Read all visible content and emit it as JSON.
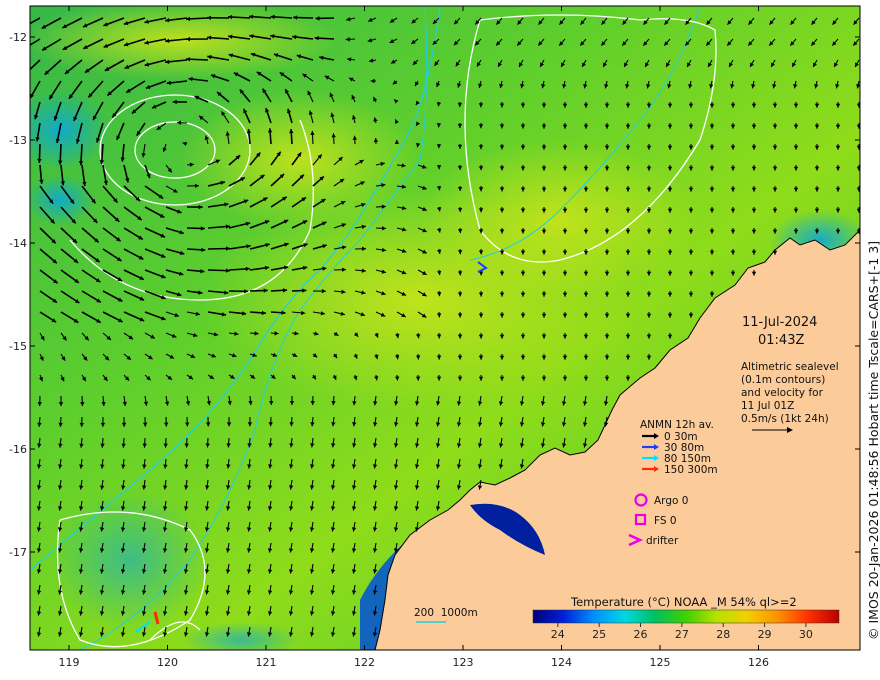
{
  "map": {
    "date": "11-Jul-2024",
    "time": "01:43Z",
    "altimetry_note": [
      "Altimetric sealevel",
      "(0.1m contours)",
      "and velocity for",
      "11 Jul 01Z",
      "0.5m/s (1kt 24h)"
    ],
    "latitude_ticks": [
      "-12",
      "-13",
      "-14",
      "-15",
      "-16",
      "-17"
    ],
    "longitude_ticks": [
      "119",
      "120",
      "121",
      "122",
      "123",
      "124",
      "125",
      "126"
    ],
    "depth_legend": {
      "title": "ANMN 12h av.",
      "items": [
        {
          "label": "0 30m",
          "color": "#000000"
        },
        {
          "label": "30 80m",
          "color": "#1f3cff"
        },
        {
          "label": "80 150m",
          "color": "#00e0ff"
        },
        {
          "label": "150 300m",
          "color": "#ff2a00"
        }
      ]
    },
    "markers": [
      {
        "label": "Argo 0",
        "icon": "circle-icon",
        "color": "#e600e6"
      },
      {
        "label": "FS 0",
        "icon": "square-icon",
        "color": "#e600e6"
      },
      {
        "label": "drifter",
        "icon": "chevron-icon",
        "color": "#e600e6"
      }
    ],
    "isobath_legend": "200  1000m",
    "colorbar": {
      "title": "Temperature (°C) NOAA _M 54% ql>=2",
      "ticks": [
        "24",
        "25",
        "26",
        "27",
        "28",
        "29",
        "30"
      ],
      "min": 23.4,
      "max": 30.8,
      "colors": [
        "#00007a",
        "#0020d8",
        "#0090ff",
        "#00d8e0",
        "#00c060",
        "#40d000",
        "#b8e000",
        "#f0d000",
        "#ff9000",
        "#ff3000",
        "#b80000"
      ]
    },
    "credit": "© IMOS 20-Jan-2026 01:48:56 Hobart time Tscale=CARS+[-1 3]",
    "palette": {
      "land": "#fccb9a",
      "sea_base": "#3fc43a",
      "coast": "#000000",
      "isobath": "#20d0e0",
      "contour": "#ffffff",
      "arrow": "#000000"
    }
  }
}
